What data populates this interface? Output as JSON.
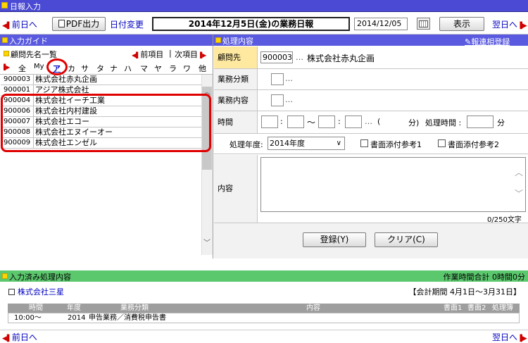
{
  "window": {
    "title": "日報入力"
  },
  "toolbar": {
    "prev_day": "前日へ",
    "pdf_button": "PDF出力",
    "date_change": "日付変更",
    "report_title": "2014年12月5日(金)の業務日報",
    "date_value": "2014/12/05",
    "show_button": "表示",
    "next_day": "翌日へ"
  },
  "guide": {
    "header": "入力ガイド",
    "section_label": "顧問先名一覧",
    "prev_item": "前項目",
    "next_item": "次項目",
    "divider": "|",
    "kana_tabs": [
      "全",
      "My",
      "ア",
      "カ",
      "サ",
      "タ",
      "ナ",
      "ハ",
      "マ",
      "ヤ",
      "ラ",
      "ワ",
      "他"
    ],
    "rows": [
      {
        "code": "900003",
        "name": "株式会社赤丸企画"
      },
      {
        "code": "900001",
        "name": "アジア株式会社"
      },
      {
        "code": "900004",
        "name": "株式会社イーチ工業"
      },
      {
        "code": "900006",
        "name": "株式会社内村建設"
      },
      {
        "code": "900007",
        "name": "株式会社エコー"
      },
      {
        "code": "900008",
        "name": "株式会社エヌイーオー"
      },
      {
        "code": "900009",
        "name": "株式会社エンゼル"
      }
    ]
  },
  "form": {
    "header": "処理内容",
    "related_link": "報連相登録",
    "client_label": "顧問先",
    "client_code": "900003",
    "client_dots": "…",
    "client_name": "株式会社赤丸企画",
    "category_label": "業務分類",
    "content_type_label": "業務内容",
    "dots": "…",
    "time_label": "時間",
    "colon": ":",
    "tilde": "～",
    "paren_open": "(",
    "minutes_close": "分)",
    "proc_time_label": "処理時間 :",
    "minutes": "分",
    "fiscal_label": "処理年度:",
    "fiscal_value": "2014年度",
    "attach1": "書面添付参考1",
    "attach2": "書面添付参考2",
    "content_label": "内容",
    "char_count": "0/250文字",
    "register_button": "登録(Y)",
    "clear_button": "クリア(C)"
  },
  "records": {
    "header": "入力済み処理内容",
    "total_time": "作業時間合計 0時間0分",
    "client_name": "株式会社三星",
    "period": "【会計期間 4月1日～3月31日】",
    "columns": [
      "時間",
      "年度",
      "業務分類",
      "内容",
      "書面1",
      "書面2",
      "処理簿"
    ],
    "row": {
      "time": "10:00～",
      "year": "2014",
      "category": "申告業務／消費税申告書"
    }
  },
  "footer": {
    "prev_day": "前日へ",
    "next_day": "翌日へ"
  },
  "colors": {
    "header_blue": "#5a5ae0",
    "accent_yellow": "#ffd400",
    "highlight_red": "#e00000",
    "records_green": "#5cc86e"
  }
}
